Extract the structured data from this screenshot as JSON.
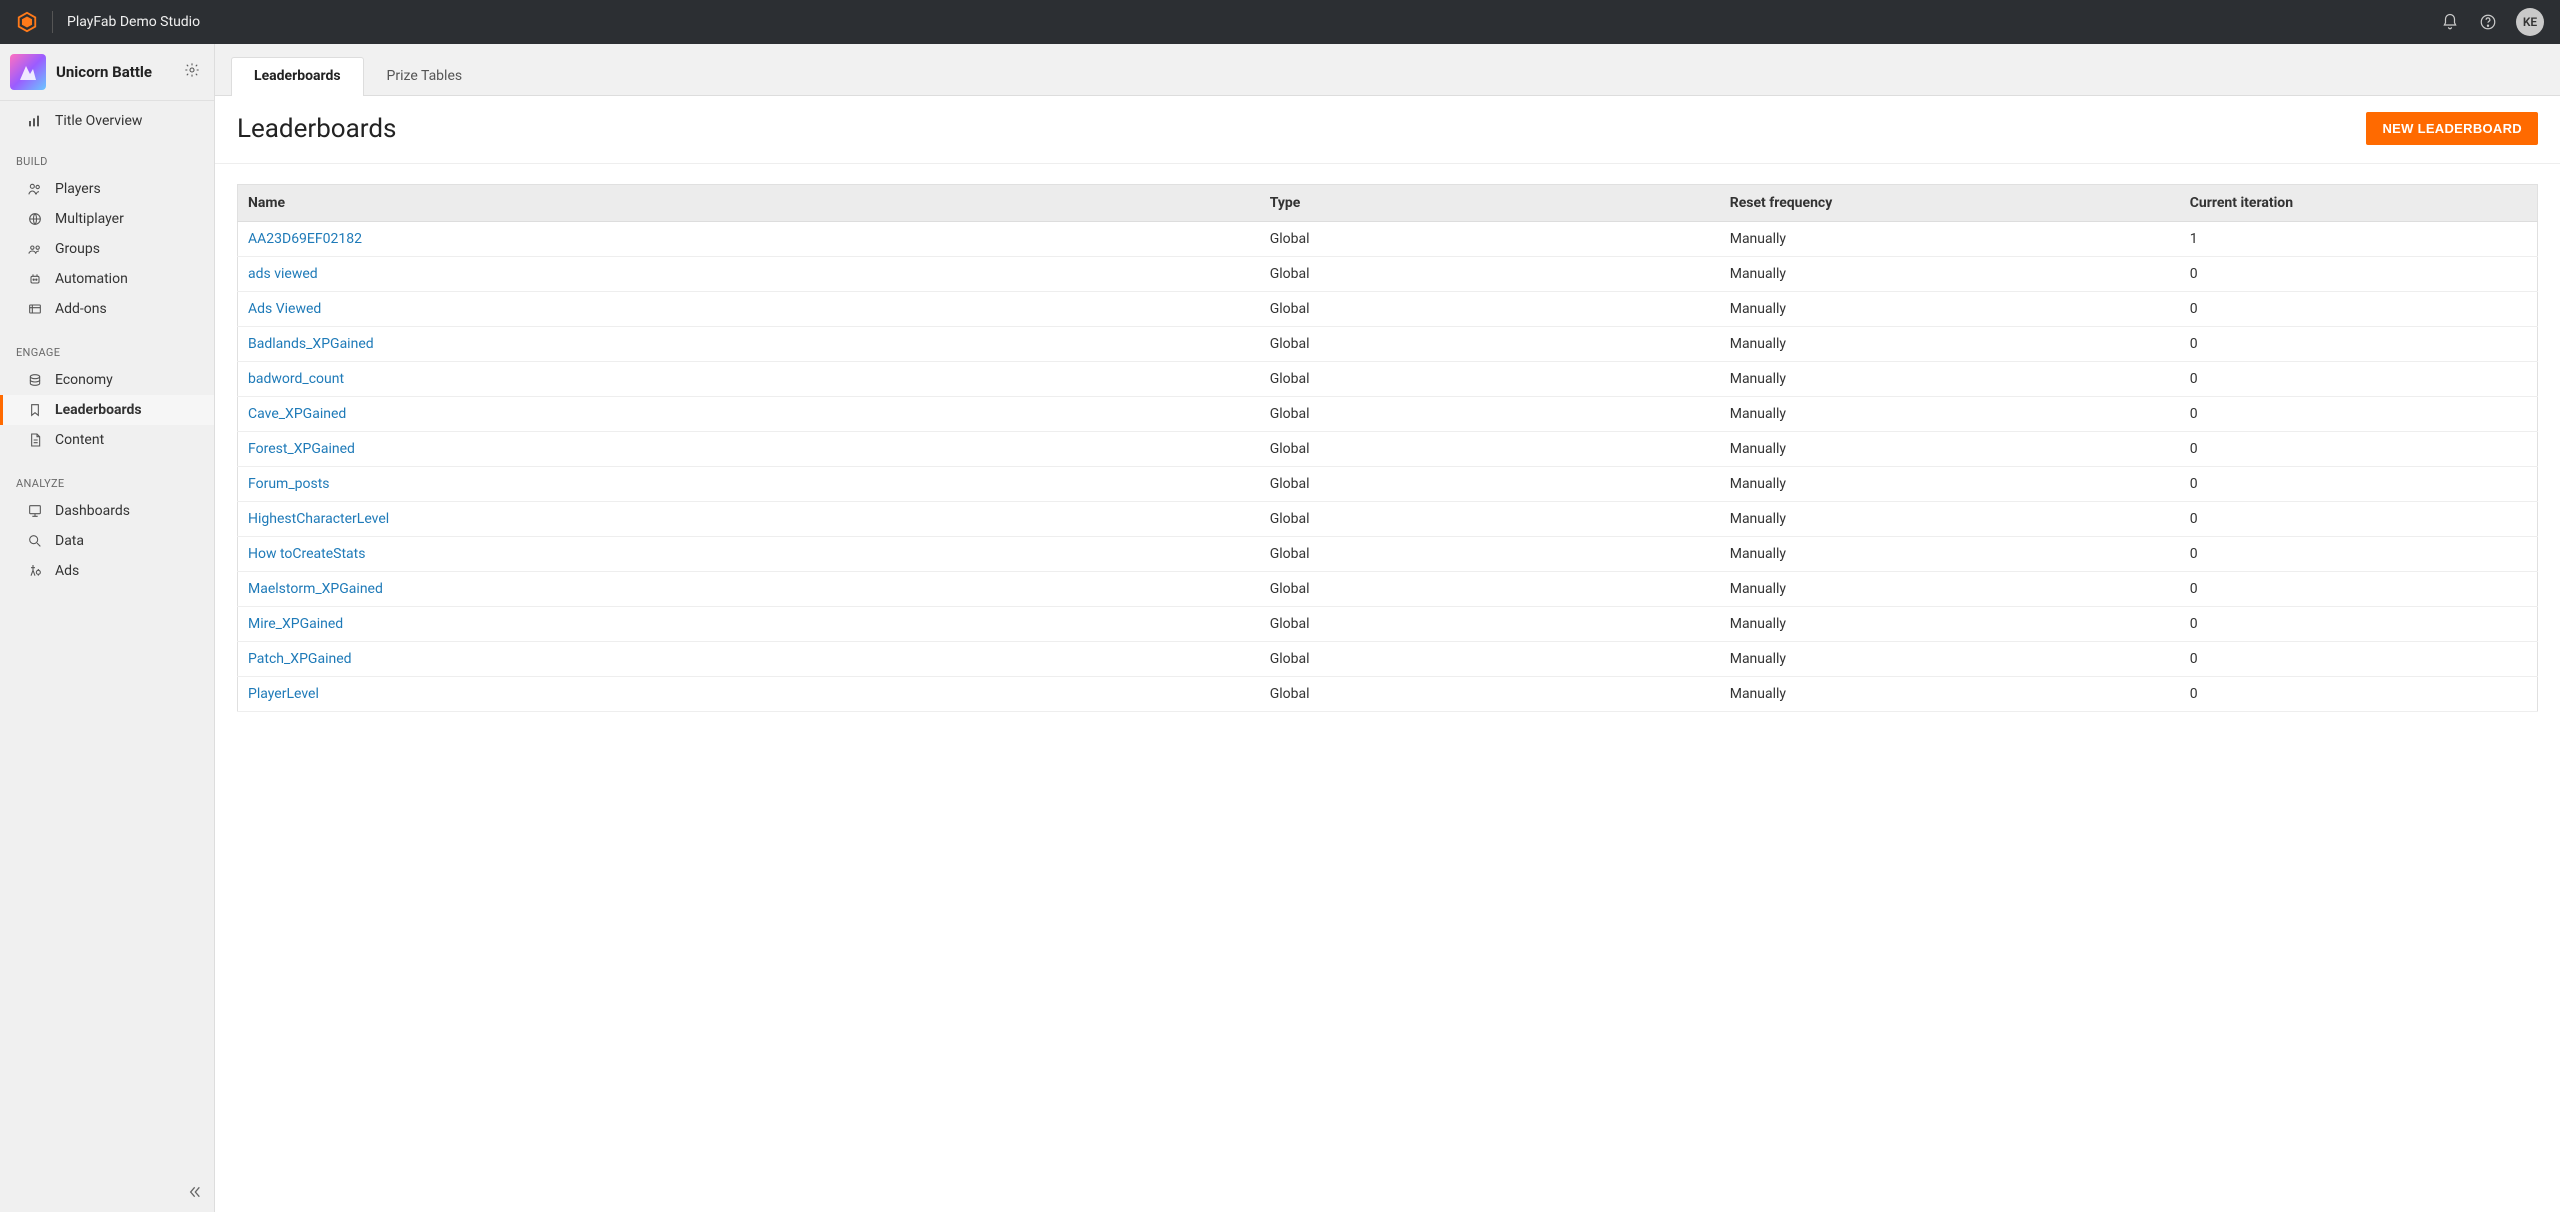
{
  "topbar": {
    "studio_name": "PlayFab Demo Studio",
    "avatar_initials": "KE"
  },
  "sidebar": {
    "title": "Unicorn Battle",
    "overview_label": "Title Overview",
    "sections": [
      {
        "label": "BUILD",
        "items": [
          {
            "icon": "players",
            "label": "Players"
          },
          {
            "icon": "globe",
            "label": "Multiplayer"
          },
          {
            "icon": "groups",
            "label": "Groups"
          },
          {
            "icon": "automation",
            "label": "Automation"
          },
          {
            "icon": "addons",
            "label": "Add-ons"
          }
        ]
      },
      {
        "label": "ENGAGE",
        "items": [
          {
            "icon": "economy",
            "label": "Economy"
          },
          {
            "icon": "bookmark",
            "label": "Leaderboards",
            "active": true
          },
          {
            "icon": "content",
            "label": "Content"
          }
        ]
      },
      {
        "label": "ANALYZE",
        "items": [
          {
            "icon": "dashboards",
            "label": "Dashboards"
          },
          {
            "icon": "data",
            "label": "Data"
          },
          {
            "icon": "ads",
            "label": "Ads"
          }
        ]
      }
    ]
  },
  "tabs": [
    {
      "label": "Leaderboards",
      "active": true
    },
    {
      "label": "Prize Tables",
      "active": false
    }
  ],
  "page": {
    "title": "Leaderboards",
    "new_button": "NEW LEADERBOARD"
  },
  "table": {
    "columns": [
      "Name",
      "Type",
      "Reset frequency",
      "Current iteration"
    ],
    "rows": [
      {
        "name": "AA23D69EF02182",
        "type": "Global",
        "reset": "Manually",
        "iter": "1"
      },
      {
        "name": "ads viewed",
        "type": "Global",
        "reset": "Manually",
        "iter": "0"
      },
      {
        "name": "Ads Viewed",
        "type": "Global",
        "reset": "Manually",
        "iter": "0"
      },
      {
        "name": "Badlands_XPGained",
        "type": "Global",
        "reset": "Manually",
        "iter": "0"
      },
      {
        "name": "badword_count",
        "type": "Global",
        "reset": "Manually",
        "iter": "0"
      },
      {
        "name": "Cave_XPGained",
        "type": "Global",
        "reset": "Manually",
        "iter": "0"
      },
      {
        "name": "Forest_XPGained",
        "type": "Global",
        "reset": "Manually",
        "iter": "0"
      },
      {
        "name": "Forum_posts",
        "type": "Global",
        "reset": "Manually",
        "iter": "0"
      },
      {
        "name": "HighestCharacterLevel",
        "type": "Global",
        "reset": "Manually",
        "iter": "0"
      },
      {
        "name": "How toCreateStats",
        "type": "Global",
        "reset": "Manually",
        "iter": "0"
      },
      {
        "name": "Maelstorm_XPGained",
        "type": "Global",
        "reset": "Manually",
        "iter": "0"
      },
      {
        "name": "Mire_XPGained",
        "type": "Global",
        "reset": "Manually",
        "iter": "0"
      },
      {
        "name": "Patch_XPGained",
        "type": "Global",
        "reset": "Manually",
        "iter": "0"
      },
      {
        "name": "PlayerLevel",
        "type": "Global",
        "reset": "Manually",
        "iter": "0"
      }
    ]
  }
}
